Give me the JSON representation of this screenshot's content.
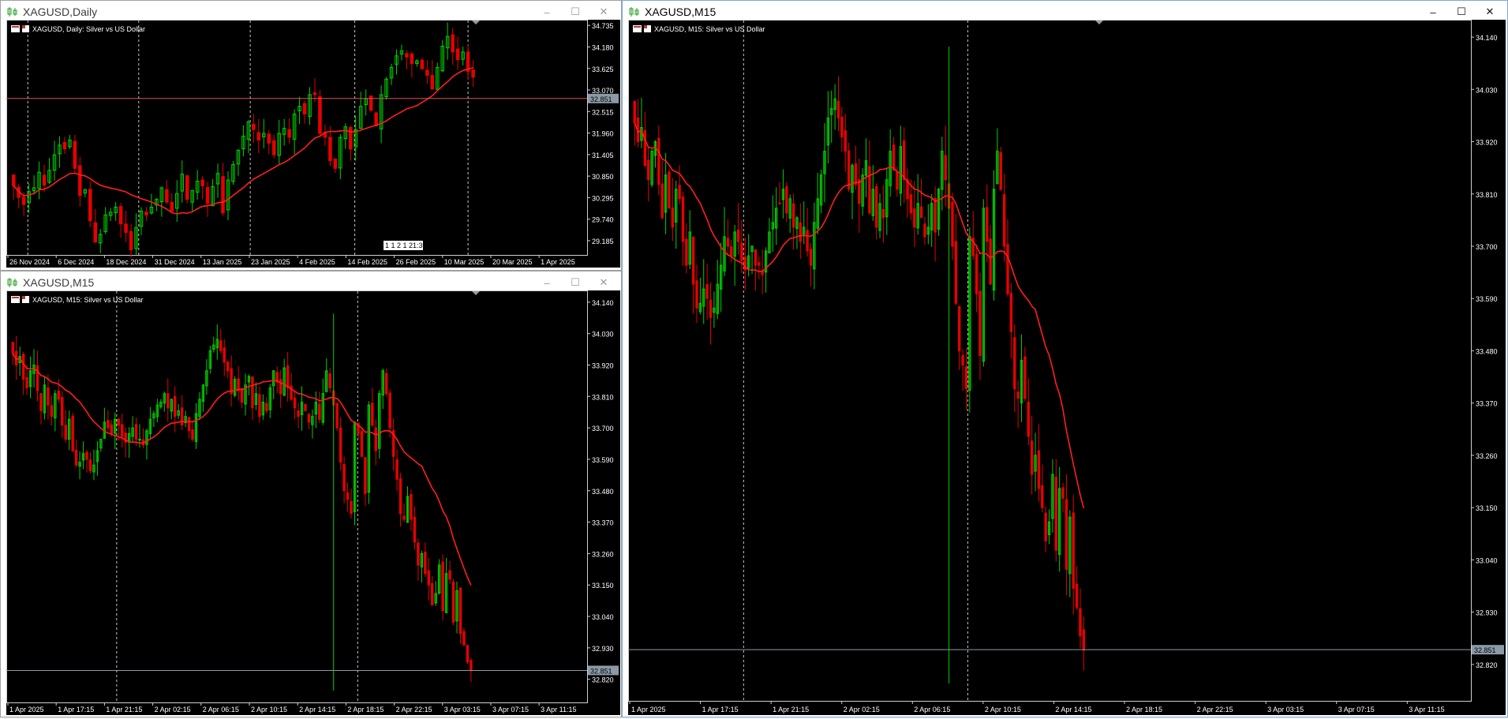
{
  "colors": {
    "background": "#000000",
    "grid": "#c8c8c8",
    "axis_text": "#ffffff",
    "bull": "#00d000",
    "bear": "#e60000",
    "ma": "#ff1e1e",
    "price_line": "#e0505a",
    "bid_line": "#8c9aa8",
    "price_label_bg": "#8c9aa8"
  },
  "windows": {
    "daily": {
      "title": "XAGUSD,Daily",
      "chart_label": "XAGUSD, Daily:  Silver vs US Dollar",
      "current_price": "32.851",
      "timer_text": "1 1 2 1 21:30"
    },
    "m15a": {
      "title": "XAGUSD,M15",
      "chart_label": "XAGUSD, M15:  Silver vs US Dollar",
      "current_price": "32.851"
    },
    "m15b": {
      "title": "XAGUSD,M15",
      "chart_label": "XAGUSD, M15:  Silver vs US Dollar",
      "current_price": "32.851"
    }
  },
  "window_buttons": {
    "minimize": "–",
    "maximize": "☐",
    "close": "✕"
  },
  "chart_data": [
    {
      "type": "candlestick",
      "title": "XAGUSD, Daily:  Silver vs US Dollar",
      "ylim": [
        28.9,
        34.8
      ],
      "y_ticks": [
        "34.735",
        "34.180",
        "33.625",
        "33.070",
        "32.515",
        "31.960",
        "31.405",
        "30.850",
        "30.295",
        "29.740",
        "29.185"
      ],
      "x_labels": [
        "26 Nov 2024",
        "6 Dec 2024",
        "18 Dec 2024",
        "31 Dec 2024",
        "13 Jan 2025",
        "23 Jan 2025",
        "4 Feb 2025",
        "14 Feb 2025",
        "26 Feb 2025",
        "10 Mar 2025",
        "20 Mar 2025",
        "1 Apr 2025"
      ],
      "session_separators": [
        "1 Dec 2024",
        "1 Jan 2025",
        "1 Feb 2025",
        "1 Mar 2025",
        "1 Apr 2025"
      ],
      "current_price": 32.851,
      "ma_period_hint": "moving average (red)",
      "closes": [
        30.6,
        30.3,
        30.12,
        30.45,
        30.55,
        30.95,
        30.62,
        31.0,
        31.4,
        31.65,
        31.55,
        31.78,
        31.05,
        30.35,
        30.5,
        29.7,
        29.15,
        29.35,
        29.85,
        29.92,
        30.05,
        29.62,
        29.4,
        28.95,
        29.52,
        29.95,
        29.85,
        30.05,
        30.25,
        30.55,
        30.18,
        29.95,
        30.4,
        30.9,
        30.25,
        30.48,
        30.72,
        30.6,
        30.15,
        30.58,
        30.92,
        29.9,
        30.75,
        31.15,
        31.52,
        31.88,
        32.25,
        32.05,
        31.78,
        31.95,
        31.7,
        31.4,
        31.95,
        32.08,
        31.85,
        32.45,
        32.65,
        32.45,
        32.95,
        32.95,
        31.95,
        31.85,
        31.25,
        31.05,
        31.85,
        32.12,
        31.55,
        32.05,
        32.65,
        32.85,
        32.55,
        32.15,
        32.95,
        33.35,
        33.65,
        33.95,
        34.08,
        33.92,
        33.75,
        33.82,
        33.62,
        33.45,
        33.1,
        33.65,
        34.2,
        34.45,
        34.05,
        33.85,
        34.05,
        33.55,
        33.4
      ]
    },
    {
      "type": "candlestick",
      "title": "XAGUSD, M15:  Silver vs US Dollar",
      "ylim": [
        32.75,
        34.17
      ],
      "y_ticks": [
        "34.140",
        "34.030",
        "33.920",
        "33.810",
        "33.700",
        "33.590",
        "33.480",
        "33.370",
        "33.260",
        "33.150",
        "33.040",
        "32.930",
        "32.820"
      ],
      "x_labels": [
        "1 Apr 2025",
        "1 Apr 17:15",
        "1 Apr 21:15",
        "2 Apr 02:15",
        "2 Apr 06:15",
        "2 Apr 10:15",
        "2 Apr 14:15",
        "2 Apr 18:15",
        "2 Apr 22:15",
        "3 Apr 03:15",
        "3 Apr 07:15",
        "3 Apr 11:15"
      ],
      "session_separators": [
        "2 Apr 2025",
        "3 Apr 2025"
      ],
      "current_price": 32.851,
      "closes": [
        33.96,
        33.92,
        33.95,
        33.87,
        33.84,
        33.9,
        33.92,
        33.83,
        33.76,
        33.85,
        33.78,
        33.74,
        33.82,
        33.8,
        33.71,
        33.66,
        33.73,
        33.62,
        33.57,
        33.58,
        33.61,
        33.59,
        33.55,
        33.57,
        33.62,
        33.66,
        33.72,
        33.7,
        33.68,
        33.73,
        33.71,
        33.67,
        33.65,
        33.68,
        33.7,
        33.66,
        33.66,
        33.64,
        33.69,
        33.73,
        33.75,
        33.78,
        33.79,
        33.82,
        33.77,
        33.8,
        33.74,
        33.76,
        33.71,
        33.74,
        33.69,
        33.66,
        33.75,
        33.8,
        33.85,
        33.9,
        33.97,
        33.99,
        34.01,
        33.97,
        33.93,
        33.9,
        33.82,
        33.87,
        33.83,
        33.79,
        33.85,
        33.88,
        33.77,
        33.82,
        33.74,
        33.79,
        33.76,
        33.84,
        33.9,
        33.86,
        33.82,
        33.91,
        33.84,
        33.8,
        33.77,
        33.74,
        33.79,
        33.76,
        33.72,
        33.74,
        33.79,
        33.73,
        33.82,
        33.9,
        33.84,
        33.78,
        33.7,
        33.58,
        33.48,
        33.45,
        33.4,
        33.72,
        33.68,
        33.6,
        33.47,
        33.78,
        33.71,
        33.62,
        33.82,
        33.9,
        33.82,
        33.7,
        33.6,
        33.52,
        33.4,
        33.38,
        33.46,
        33.38,
        33.3,
        33.22,
        33.26,
        33.19,
        33.15,
        33.08,
        33.12,
        33.22,
        33.06,
        33.19,
        33.17,
        33.02,
        33.13,
        32.98,
        32.94,
        32.88,
        32.85
      ]
    }
  ]
}
